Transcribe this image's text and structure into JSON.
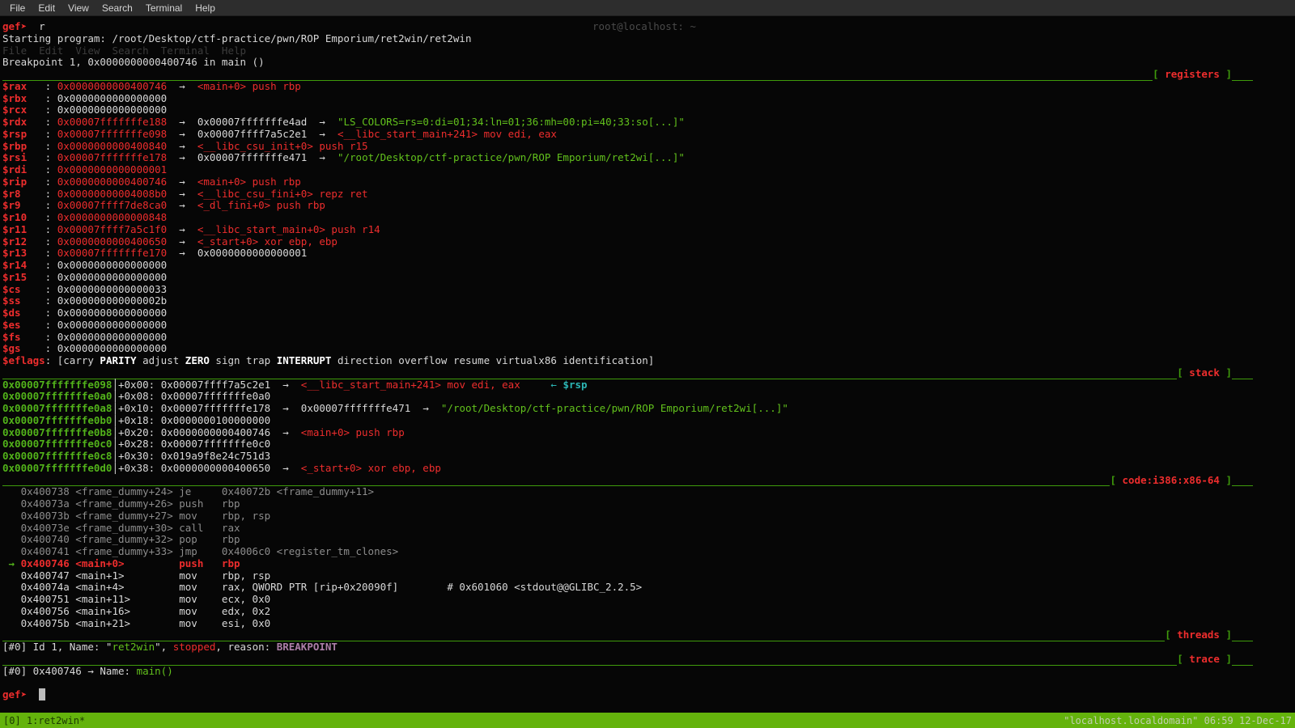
{
  "menubar": {
    "items": [
      "File",
      "Edit",
      "View",
      "Search",
      "Terminal",
      "Help"
    ]
  },
  "ghost": {
    "title": "root@localhost: ~"
  },
  "statusbar": {
    "left": "[0] 1:ret2win*",
    "right": "\"localhost.localdomain\" 06:59 12-Dec-17"
  },
  "terminal": {
    "lines": [
      [
        [
          "gef➤",
          "rb"
        ],
        [
          "  r",
          "w"
        ]
      ],
      [
        [
          "Starting program: /root/Desktop/ctf-practice/pwn/ROP Emporium/ret2win/ret2win",
          "w"
        ]
      ],
      [
        [
          "File  Edit  View  Search  Terminal  Help",
          "gh"
        ]
      ],
      [
        [
          "Breakpoint 1, 0x0000000000400746 in main ()",
          "w"
        ]
      ],
      {
        "sep": {
          "open": "[ ",
          "title": "registers",
          "close": " ]"
        }
      },
      [
        [
          "$rax",
          "rb"
        ],
        [
          "   : ",
          "w"
        ],
        [
          "0x0000000000400746",
          "r"
        ],
        [
          "  →  ",
          "w"
        ],
        [
          "<main+0> push rbp",
          "r"
        ]
      ],
      [
        [
          "$rbx",
          "rb"
        ],
        [
          "   : ",
          "w"
        ],
        [
          "0x0000000000000000",
          "w"
        ]
      ],
      [
        [
          "$rcx",
          "rb"
        ],
        [
          "   : ",
          "w"
        ],
        [
          "0x0000000000000000",
          "w"
        ]
      ],
      [
        [
          "$rdx",
          "rb"
        ],
        [
          "   : ",
          "w"
        ],
        [
          "0x00007fffffffe188",
          "r"
        ],
        [
          "  →  ",
          "w"
        ],
        [
          "0x00007fffffffe4ad",
          "w"
        ],
        [
          "  →  ",
          "w"
        ],
        [
          "\"LS_COLORS=rs=0:di=01;34:ln=01;36:mh=00:pi=40;33:so[...]\"",
          "g"
        ]
      ],
      [
        [
          "$rsp",
          "rb"
        ],
        [
          "   : ",
          "w"
        ],
        [
          "0x00007fffffffe098",
          "r"
        ],
        [
          "  →  ",
          "w"
        ],
        [
          "0x00007ffff7a5c2e1",
          "w"
        ],
        [
          "  →  ",
          "w"
        ],
        [
          "<__libc_start_main+241> mov edi, eax",
          "r"
        ]
      ],
      [
        [
          "$rbp",
          "rb"
        ],
        [
          "   : ",
          "w"
        ],
        [
          "0x0000000000400840",
          "r"
        ],
        [
          "  →  ",
          "w"
        ],
        [
          "<__libc_csu_init+0> push r15",
          "r"
        ]
      ],
      [
        [
          "$rsi",
          "rb"
        ],
        [
          "   : ",
          "w"
        ],
        [
          "0x00007fffffffe178",
          "r"
        ],
        [
          "  →  ",
          "w"
        ],
        [
          "0x00007fffffffe471",
          "w"
        ],
        [
          "  →  ",
          "w"
        ],
        [
          "\"/root/Desktop/ctf-practice/pwn/ROP Emporium/ret2wi[...]\"",
          "g"
        ]
      ],
      [
        [
          "$rdi",
          "rb"
        ],
        [
          "   : ",
          "w"
        ],
        [
          "0x0000000000000001",
          "r"
        ]
      ],
      [
        [
          "$rip",
          "rb"
        ],
        [
          "   : ",
          "w"
        ],
        [
          "0x0000000000400746",
          "r"
        ],
        [
          "  →  ",
          "w"
        ],
        [
          "<main+0> push rbp",
          "r"
        ]
      ],
      [
        [
          "$r8",
          "rb"
        ],
        [
          "    : ",
          "w"
        ],
        [
          "0x00000000004008b0",
          "r"
        ],
        [
          "  →  ",
          "w"
        ],
        [
          "<__libc_csu_fini+0> repz ret",
          "r"
        ]
      ],
      [
        [
          "$r9",
          "rb"
        ],
        [
          "    : ",
          "w"
        ],
        [
          "0x00007ffff7de8ca0",
          "r"
        ],
        [
          "  →  ",
          "w"
        ],
        [
          "<_dl_fini+0> push rbp",
          "r"
        ]
      ],
      [
        [
          "$r10",
          "rb"
        ],
        [
          "   : ",
          "w"
        ],
        [
          "0x0000000000000848",
          "r"
        ]
      ],
      [
        [
          "$r11",
          "rb"
        ],
        [
          "   : ",
          "w"
        ],
        [
          "0x00007ffff7a5c1f0",
          "r"
        ],
        [
          "  →  ",
          "w"
        ],
        [
          "<__libc_start_main+0> push r14",
          "r"
        ]
      ],
      [
        [
          "$r12",
          "rb"
        ],
        [
          "   : ",
          "w"
        ],
        [
          "0x0000000000400650",
          "r"
        ],
        [
          "  →  ",
          "w"
        ],
        [
          "<_start+0> xor ebp, ebp",
          "r"
        ]
      ],
      [
        [
          "$r13",
          "rb"
        ],
        [
          "   : ",
          "w"
        ],
        [
          "0x00007fffffffe170",
          "r"
        ],
        [
          "  →  ",
          "w"
        ],
        [
          "0x0000000000000001",
          "w"
        ]
      ],
      [
        [
          "$r14",
          "rb"
        ],
        [
          "   : ",
          "w"
        ],
        [
          "0x0000000000000000",
          "w"
        ]
      ],
      [
        [
          "$r15",
          "rb"
        ],
        [
          "   : ",
          "w"
        ],
        [
          "0x0000000000000000",
          "w"
        ]
      ],
      [
        [
          "$cs",
          "rb"
        ],
        [
          "    : ",
          "w"
        ],
        [
          "0x0000000000000033",
          "w"
        ]
      ],
      [
        [
          "$ss",
          "rb"
        ],
        [
          "    : ",
          "w"
        ],
        [
          "0x000000000000002b",
          "w"
        ]
      ],
      [
        [
          "$ds",
          "rb"
        ],
        [
          "    : ",
          "w"
        ],
        [
          "0x0000000000000000",
          "w"
        ]
      ],
      [
        [
          "$es",
          "rb"
        ],
        [
          "    : ",
          "w"
        ],
        [
          "0x0000000000000000",
          "w"
        ]
      ],
      [
        [
          "$fs",
          "rb"
        ],
        [
          "    : ",
          "w"
        ],
        [
          "0x0000000000000000",
          "w"
        ]
      ],
      [
        [
          "$gs",
          "rb"
        ],
        [
          "    : ",
          "w"
        ],
        [
          "0x0000000000000000",
          "w"
        ]
      ],
      [
        [
          "$eflags",
          "rb"
        ],
        [
          ": [",
          "w"
        ],
        [
          "carry ",
          "w"
        ],
        [
          "PARITY",
          "wb"
        ],
        [
          " adjust ",
          "w"
        ],
        [
          "ZERO",
          "wb"
        ],
        [
          " sign trap ",
          "w"
        ],
        [
          "INTERRUPT",
          "wb"
        ],
        [
          " direction overflow resume virtualx86 identification]",
          "w"
        ]
      ],
      {
        "sep": {
          "open": "[ ",
          "title": "stack",
          "close": " ]"
        }
      },
      [
        [
          "0x00007fffffffe098",
          "gb"
        ],
        [
          "│",
          "w"
        ],
        [
          "+0x00: ",
          "w"
        ],
        [
          "0x00007ffff7a5c2e1",
          "w"
        ],
        [
          "  →  ",
          "w"
        ],
        [
          "<__libc_start_main+241> mov edi, eax",
          "r"
        ],
        [
          "     ",
          "w"
        ],
        [
          "← ",
          "c"
        ],
        [
          "$rsp",
          "cb"
        ]
      ],
      [
        [
          "0x00007fffffffe0a0",
          "gb"
        ],
        [
          "│",
          "w"
        ],
        [
          "+0x08: ",
          "w"
        ],
        [
          "0x00007fffffffe0a0",
          "w"
        ]
      ],
      [
        [
          "0x00007fffffffe0a8",
          "gb"
        ],
        [
          "│",
          "w"
        ],
        [
          "+0x10: ",
          "w"
        ],
        [
          "0x00007fffffffe178",
          "w"
        ],
        [
          "  →  ",
          "w"
        ],
        [
          "0x00007fffffffe471",
          "w"
        ],
        [
          "  →  ",
          "w"
        ],
        [
          "\"/root/Desktop/ctf-practice/pwn/ROP Emporium/ret2wi[...]\"",
          "g"
        ]
      ],
      [
        [
          "0x00007fffffffe0b0",
          "gb"
        ],
        [
          "│",
          "w"
        ],
        [
          "+0x18: ",
          "w"
        ],
        [
          "0x0000000100000000",
          "w"
        ]
      ],
      [
        [
          "0x00007fffffffe0b8",
          "gb"
        ],
        [
          "│",
          "w"
        ],
        [
          "+0x20: ",
          "w"
        ],
        [
          "0x0000000000400746",
          "w"
        ],
        [
          "  →  ",
          "w"
        ],
        [
          "<main+0> push rbp",
          "r"
        ]
      ],
      [
        [
          "0x00007fffffffe0c0",
          "gb"
        ],
        [
          "│",
          "w"
        ],
        [
          "+0x28: ",
          "w"
        ],
        [
          "0x00007fffffffe0c0",
          "w"
        ]
      ],
      [
        [
          "0x00007fffffffe0c8",
          "gb"
        ],
        [
          "│",
          "w"
        ],
        [
          "+0x30: ",
          "w"
        ],
        [
          "0x019a9f8e24c751d3",
          "w"
        ]
      ],
      [
        [
          "0x00007fffffffe0d0",
          "gb"
        ],
        [
          "│",
          "w"
        ],
        [
          "+0x38: ",
          "w"
        ],
        [
          "0x0000000000400650",
          "w"
        ],
        [
          "  →  ",
          "w"
        ],
        [
          "<_start+0> xor ebp, ebp",
          "r"
        ]
      ],
      {
        "sep": {
          "open": "[ ",
          "title": "code:i386:x86-64",
          "close": " ]"
        }
      },
      [
        [
          "   0x400738 <frame_dummy+24> je     0x40072b <frame_dummy+11>",
          "d"
        ]
      ],
      [
        [
          "   0x40073a <frame_dummy+26> push   rbp",
          "d"
        ]
      ],
      [
        [
          "   0x40073b <frame_dummy+27> mov    rbp, rsp",
          "d"
        ]
      ],
      [
        [
          "   0x40073e <frame_dummy+30> call   rax",
          "d"
        ]
      ],
      [
        [
          "   0x400740 <frame_dummy+32> pop    rbp",
          "d"
        ]
      ],
      [
        [
          "   0x400741 <frame_dummy+33> jmp    0x4006c0 <register_tm_clones>",
          "d"
        ]
      ],
      [
        [
          " → ",
          "gb"
        ],
        [
          "0x400746 <main+0>         push   rbp",
          "rb"
        ]
      ],
      [
        [
          "   0x400747 <main+1>         mov    rbp, rsp",
          "w"
        ]
      ],
      [
        [
          "   0x40074a <main+4>         mov    rax, QWORD PTR [rip+0x20090f]        # 0x601060 <stdout@@GLIBC_2.2.5>",
          "w"
        ]
      ],
      [
        [
          "   0x400751 <main+11>        mov    ecx, 0x0",
          "w"
        ]
      ],
      [
        [
          "   0x400756 <main+16>        mov    edx, 0x2",
          "w"
        ]
      ],
      [
        [
          "   0x40075b <main+21>        mov    esi, 0x0",
          "w"
        ]
      ],
      {
        "sep": {
          "open": "[ ",
          "title": "threads",
          "close": " ]"
        }
      },
      [
        [
          "[#0] Id 1, Name: \"",
          "w"
        ],
        [
          "ret2win",
          "g"
        ],
        [
          "\", ",
          "w"
        ],
        [
          "stopped",
          "r"
        ],
        [
          ", reason: ",
          "w"
        ],
        [
          "BREAKPOINT",
          "p"
        ]
      ],
      {
        "sep": {
          "open": "[ ",
          "title": "trace",
          "close": " ]"
        }
      },
      [
        [
          "[#0] 0x400746 → Name: ",
          "w"
        ],
        [
          "main()",
          "g"
        ]
      ],
      [
        [
          "",
          "w"
        ]
      ],
      [
        [
          "gef➤",
          "rb"
        ],
        [
          "  ",
          "w"
        ],
        [
          " ",
          "cur"
        ]
      ]
    ]
  }
}
